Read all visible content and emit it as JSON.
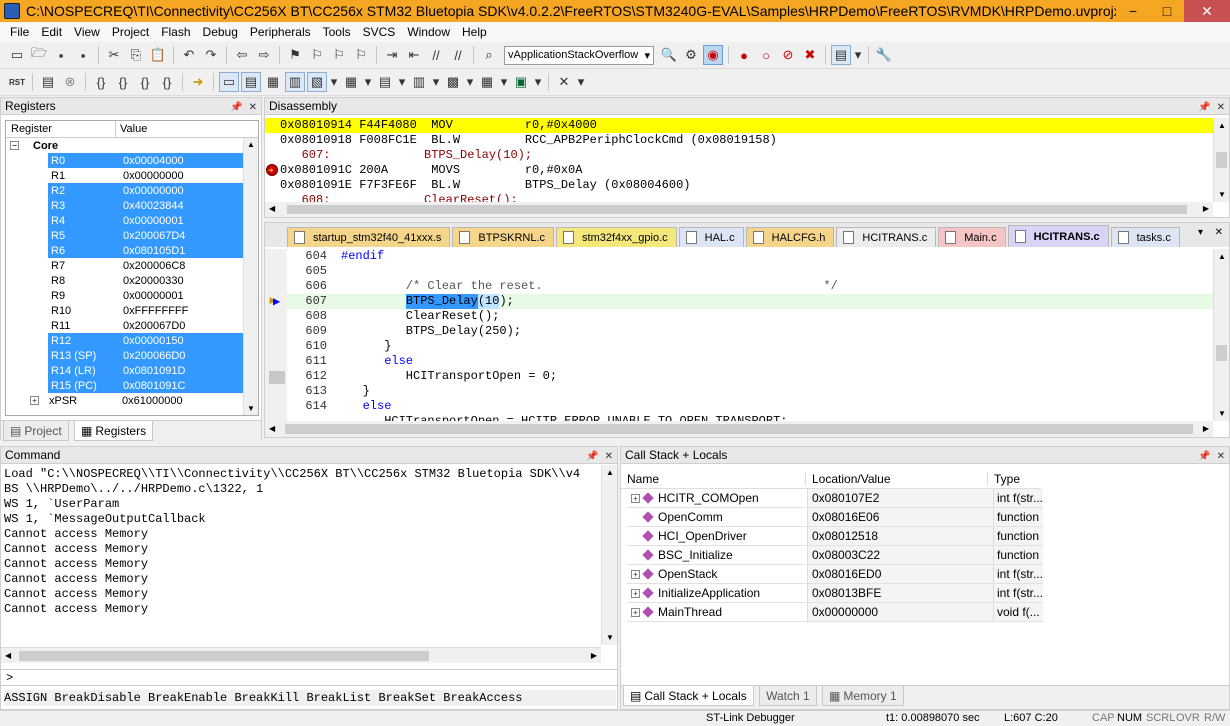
{
  "title": "C:\\NOSPECREQ\\TI\\Connectivity\\CC256X BT\\CC256x STM32 Bluetopia SDK\\v4.0.2.2\\FreeRTOS\\STM3240G-EVAL\\Samples\\HRPDemo\\FreeRTOS\\RVMDK\\HRPDemo.uvprojx - µVision",
  "window_buttons": {
    "minimize": "−",
    "maximize": "□",
    "close": "✕"
  },
  "menu": [
    "File",
    "Edit",
    "View",
    "Project",
    "Flash",
    "Debug",
    "Peripherals",
    "Tools",
    "SVCS",
    "Window",
    "Help"
  ],
  "toolbar": {
    "function_combo": "vApplicationStackOverflow"
  },
  "registers": {
    "title": "Registers",
    "col_register": "Register",
    "col_value": "Value",
    "group": "Core",
    "rows": [
      {
        "name": "R0",
        "value": "0x00004000",
        "selected": true
      },
      {
        "name": "R1",
        "value": "0x00000000",
        "selected": false
      },
      {
        "name": "R2",
        "value": "0x00000000",
        "selected": true
      },
      {
        "name": "R3",
        "value": "0x40023844",
        "selected": true
      },
      {
        "name": "R4",
        "value": "0x00000001",
        "selected": true
      },
      {
        "name": "R5",
        "value": "0x200067D4",
        "selected": true
      },
      {
        "name": "R6",
        "value": "0x080105D1",
        "selected": true
      },
      {
        "name": "R7",
        "value": "0x200006C8",
        "selected": false
      },
      {
        "name": "R8",
        "value": "0x20000330",
        "selected": false
      },
      {
        "name": "R9",
        "value": "0x00000001",
        "selected": false
      },
      {
        "name": "R10",
        "value": "0xFFFFFFFF",
        "selected": false
      },
      {
        "name": "R11",
        "value": "0x200067D0",
        "selected": false
      },
      {
        "name": "R12",
        "value": "0x00000150",
        "selected": true
      },
      {
        "name": "R13 (SP)",
        "value": "0x200066D0",
        "selected": true
      },
      {
        "name": "R14 (LR)",
        "value": "0x0801091D",
        "selected": true
      },
      {
        "name": "R15 (PC)",
        "value": "0x0801091C",
        "selected": true
      }
    ],
    "xpsr_name": "xPSR",
    "xpsr_value": "0x61000000",
    "tab_project": "Project",
    "tab_registers": "Registers"
  },
  "disassembly": {
    "title": "Disassembly",
    "lines": [
      "0x08010914 F44F4080  MOV          r0,#0x4000",
      "0x08010918 F008FC1E  BL.W         RCC_APB2PeriphClockCmd (0x08019158)",
      "   607:             BTPS_Delay(10);",
      "0x0801091C 200A      MOVS         r0,#0x0A",
      "0x0801091E F7F3FE6F  BL.W         BTPS_Delay (0x08004600)",
      "   608:             ClearReset();"
    ]
  },
  "editor": {
    "tabs": [
      {
        "label": "startup_stm32f40_41xxx.s",
        "color": "#f5d58a"
      },
      {
        "label": "BTPSKRNL.c",
        "color": "#f5d58a"
      },
      {
        "label": "stm32f4xx_gpio.c",
        "color": "#f5e87a"
      },
      {
        "label": "HAL.c",
        "color": "#dde5f5"
      },
      {
        "label": "HALCFG.h",
        "color": "#f5d58a"
      },
      {
        "label": "HCITRANS.c",
        "color": "#ececec"
      },
      {
        "label": "Main.c",
        "color": "#f5c4c4"
      },
      {
        "label": "HCITRANS.c",
        "color": "#d9d4f5"
      },
      {
        "label": "tasks.c",
        "color": "#dde5f5"
      }
    ],
    "lines": [
      {
        "num": "604",
        "code": "#endif"
      },
      {
        "num": "605",
        "code": ""
      },
      {
        "num": "606",
        "code": "         /* Clear the reset.                                       */"
      },
      {
        "num": "607",
        "code_pre": "         ",
        "code_hl": "BTPS_Delay",
        "code_paren": "(10",
        "code_post": ");"
      },
      {
        "num": "608",
        "code": "         ClearReset();"
      },
      {
        "num": "609",
        "code": "         BTPS_Delay(250);"
      },
      {
        "num": "610",
        "code": "      }"
      },
      {
        "num": "611",
        "code": "      else"
      },
      {
        "num": "612",
        "code": "         HCITransportOpen = 0;"
      },
      {
        "num": "613",
        "code": "   }"
      },
      {
        "num": "614",
        "code": "   else"
      }
    ],
    "partial_line": "      HCITransportOpen = HCITR_ERROR_UNABLE_TO_OPEN_TRANSPORT;"
  },
  "command": {
    "title": "Command",
    "lines": [
      "Load \"C:\\\\NOSPECREQ\\\\TI\\\\Connectivity\\\\CC256X BT\\\\CC256x STM32 Bluetopia SDK\\\\v4",
      "BS \\\\HRPDemo\\../../HRPDemo.c\\1322, 1",
      "WS 1, `UserParam",
      "WS 1, `MessageOutputCallback",
      "Cannot access Memory",
      "Cannot access Memory",
      "Cannot access Memory",
      "Cannot access Memory",
      "Cannot access Memory",
      "Cannot access Memory"
    ],
    "prompt": ">",
    "hint": "ASSIGN BreakDisable BreakEnable BreakKill BreakList BreakSet BreakAccess"
  },
  "callstack": {
    "title": "Call Stack + Locals",
    "col_name": "Name",
    "col_location": "Location/Value",
    "col_type": "Type",
    "rows": [
      {
        "name": "HCITR_COMOpen",
        "location": "0x080107E2",
        "type": "int f(str...",
        "expandable": true
      },
      {
        "name": "OpenComm",
        "location": "0x08016E06",
        "type": "function",
        "expandable": false
      },
      {
        "name": "HCI_OpenDriver",
        "location": "0x08012518",
        "type": "function",
        "expandable": false
      },
      {
        "name": "BSC_Initialize",
        "location": "0x08003C22",
        "type": "function",
        "expandable": false
      },
      {
        "name": "OpenStack",
        "location": "0x08016ED0",
        "type": "int f(str...",
        "expandable": true
      },
      {
        "name": "InitializeApplication",
        "location": "0x08013BFE",
        "type": "int f(str...",
        "expandable": true
      },
      {
        "name": "MainThread",
        "location": "0x00000000",
        "type": "void f(...",
        "expandable": true
      }
    ],
    "tabs": [
      "Call Stack + Locals",
      "Watch 1",
      "Memory 1"
    ]
  },
  "status": {
    "debugger": "ST-Link Debugger",
    "time": "t1: 0.00898070 sec",
    "position": "L:607 C:20",
    "indicators": [
      "CAP",
      "NUM",
      "SCRL",
      "OVR",
      "R/W"
    ]
  }
}
